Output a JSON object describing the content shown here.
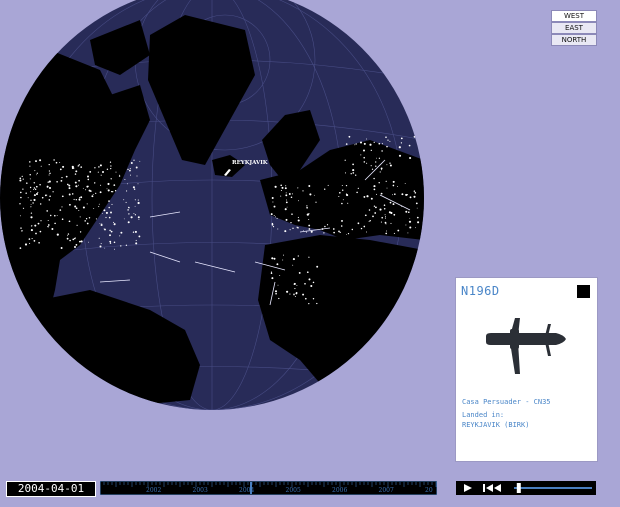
{
  "map": {
    "city_label": "REYKJAVIK",
    "colors": {
      "ocean": "#282b58",
      "land": "#000000",
      "lights": "#ffffff",
      "background": "#a9a6d6"
    }
  },
  "view_buttons": {
    "west": "WEST",
    "east": "EAST",
    "north": "NORTH",
    "active": "west"
  },
  "info_panel": {
    "flight_id": "N196D",
    "aircraft": "Casa Persuader - CN35",
    "status_label": "Landed in:",
    "location": "REYKJAVIK (BIRK)",
    "icon": "airplane-silhouette-icon"
  },
  "timeline": {
    "date": "2004-04-01",
    "years": [
      "2002",
      "2003",
      "2004",
      "2005",
      "2006",
      "2007",
      "20"
    ]
  },
  "controls": {
    "icons": [
      "play-icon",
      "rewind-icon",
      "speed-slider"
    ],
    "speed_value": 0.05
  }
}
